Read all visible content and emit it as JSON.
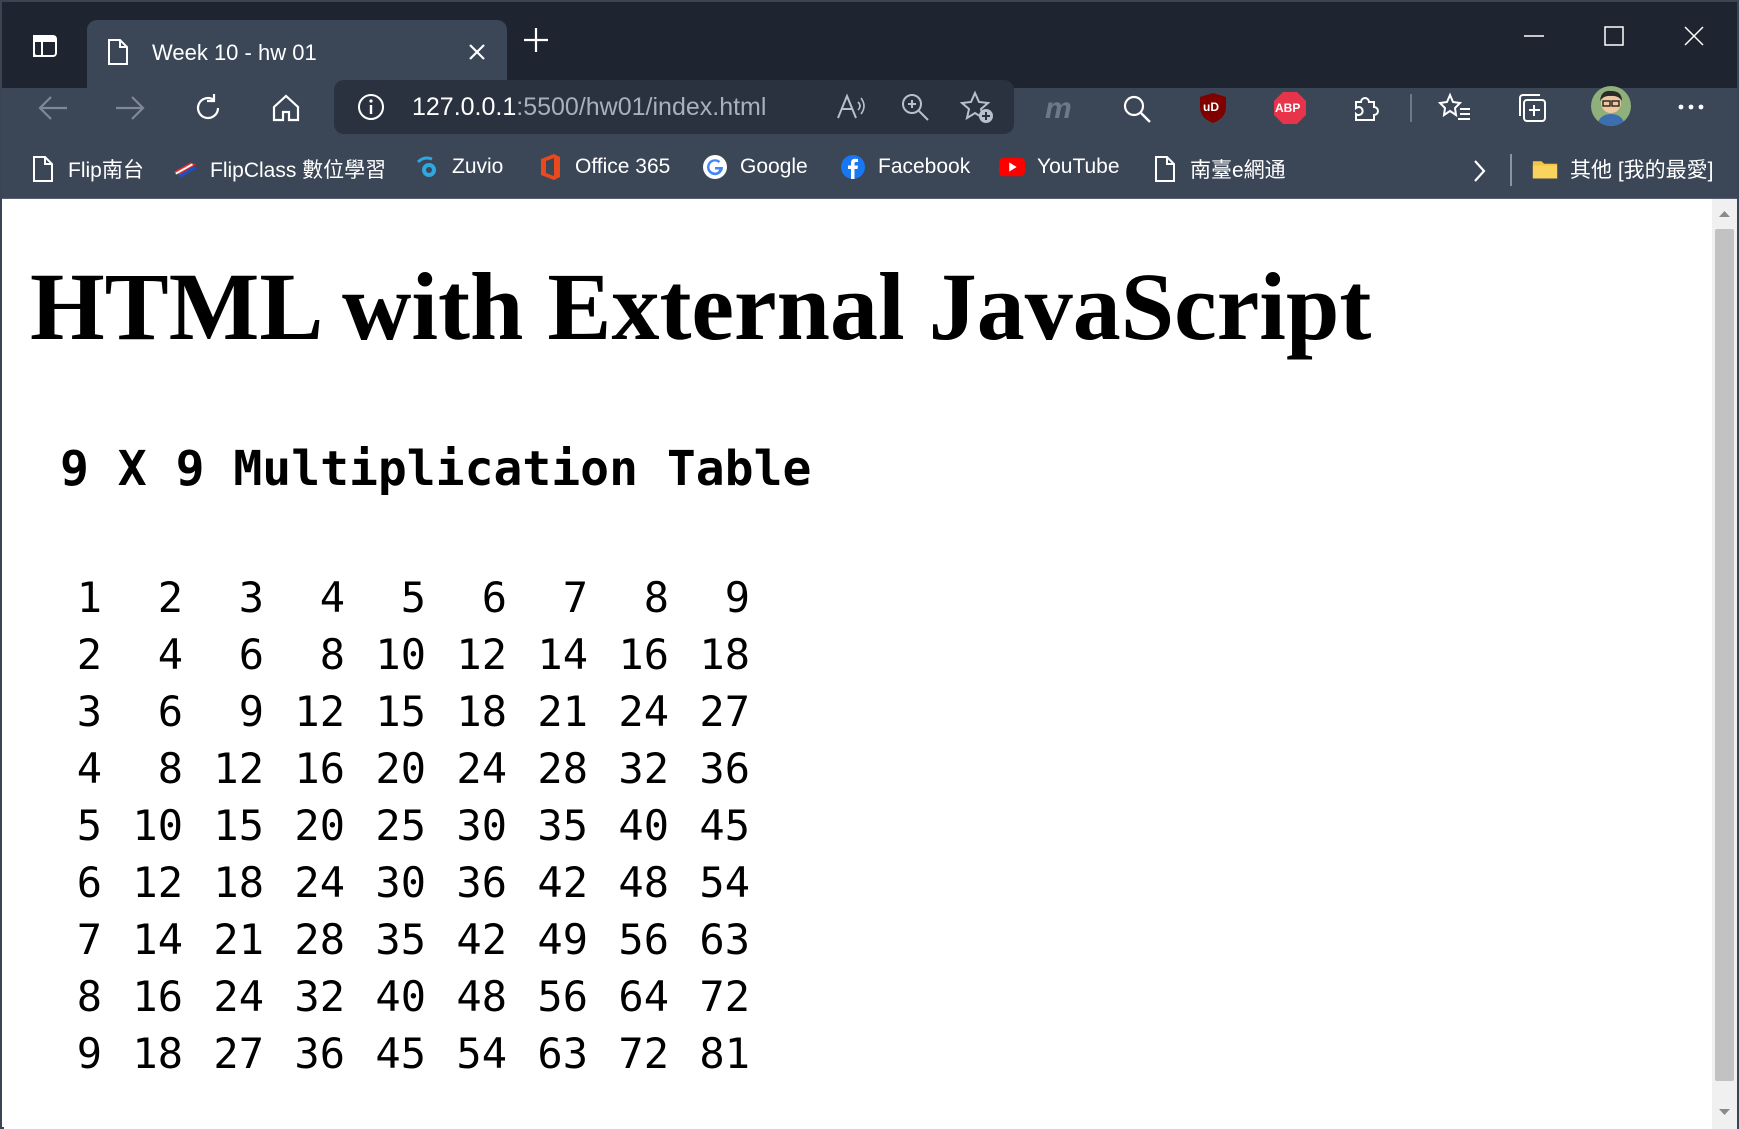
{
  "browser": {
    "tab": {
      "title": "Week 10 - hw 01"
    },
    "address": {
      "host": "127.0.0.1",
      "path": ":5500/hw01/index.html"
    },
    "bookmarks": [
      {
        "label": "Flip南台",
        "icon": "page-icon"
      },
      {
        "label": "FlipClass 數位學習",
        "icon": "flipclass-icon"
      },
      {
        "label": "Zuvio",
        "icon": "zuvio-icon"
      },
      {
        "label": "Office 365",
        "icon": "office-icon"
      },
      {
        "label": "Google",
        "icon": "google-icon"
      },
      {
        "label": "Facebook",
        "icon": "facebook-icon"
      },
      {
        "label": "YouTube",
        "icon": "youtube-icon"
      },
      {
        "label": "南臺e網通",
        "icon": "page-icon"
      }
    ],
    "other_favorites": "其他 [我的最愛]",
    "extensions": {
      "ublock": "uD",
      "abp": "ABP",
      "m": "m"
    }
  },
  "page": {
    "heading": "HTML with External JavaScript",
    "subheading": "9 X 9 Multiplication Table",
    "table": [
      [
        "1",
        "2",
        "3",
        "4",
        "5",
        "6",
        "7",
        "8",
        "9"
      ],
      [
        "2",
        "4",
        "6",
        "8",
        "10",
        "12",
        "14",
        "16",
        "18"
      ],
      [
        "3",
        "6",
        "9",
        "12",
        "15",
        "18",
        "21",
        "24",
        "27"
      ],
      [
        "4",
        "8",
        "12",
        "16",
        "20",
        "24",
        "28",
        "32",
        "36"
      ],
      [
        "5",
        "10",
        "15",
        "20",
        "25",
        "30",
        "35",
        "40",
        "45"
      ],
      [
        "6",
        "12",
        "18",
        "24",
        "30",
        "36",
        "42",
        "48",
        "54"
      ],
      [
        "7",
        "14",
        "21",
        "28",
        "35",
        "42",
        "49",
        "56",
        "63"
      ],
      [
        "8",
        "16",
        "24",
        "32",
        "40",
        "48",
        "56",
        "64",
        "72"
      ],
      [
        "9",
        "18",
        "27",
        "36",
        "45",
        "54",
        "63",
        "72",
        "81"
      ]
    ]
  },
  "colors": {
    "frame": "#1f2530",
    "toolbar": "#3b4657",
    "address": "#2a3240",
    "abp": "#e8344a",
    "ublock": "#800000"
  }
}
